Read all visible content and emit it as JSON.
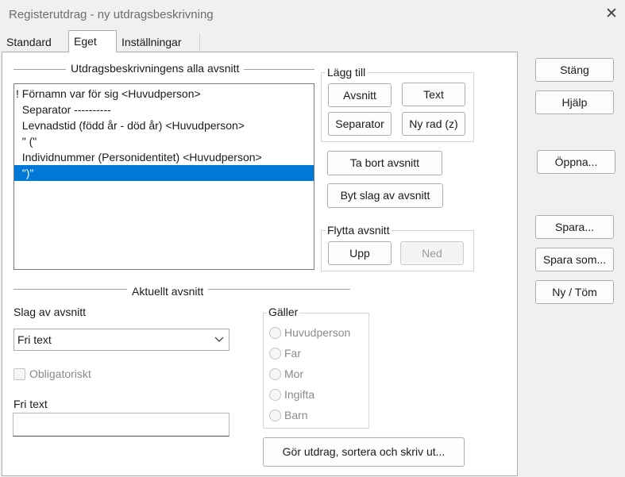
{
  "window": {
    "title": "Registerutdrag - ny utdragsbeskrivning",
    "close_glyph": "✕"
  },
  "tabs": [
    {
      "label": "Standard"
    },
    {
      "label": "Eget"
    },
    {
      "label": "Inställningar"
    }
  ],
  "sections_group": {
    "title": "Utdragsbeskrivningens alla avsnitt",
    "items": [
      "! Förnamn var för sig <Huvudperson>",
      "  Separator ----------",
      "  Levnadstid (född år - död år) <Huvudperson>",
      "  \" (\"",
      "  Individnummer (Personidentitet) <Huvudperson>",
      "  \")\""
    ],
    "selected_index": 5
  },
  "add_group": {
    "title": "Lägg till",
    "buttons": {
      "avsnitt": "Avsnitt",
      "text": "Text",
      "separator": "Separator",
      "new_row": "Ny rad (z)"
    }
  },
  "remove_button": "Ta bort avsnitt",
  "change_type_button": "Byt slag av avsnitt",
  "move_group": {
    "title": "Flytta avsnitt",
    "up": "Upp",
    "down": "Ned"
  },
  "current_group": {
    "title": "Aktuellt avsnitt",
    "type_label": "Slag av avsnitt",
    "type_value": "Fri text",
    "mandatory_label": "Obligatoriskt",
    "free_text_label": "Fri text",
    "free_text_value": ""
  },
  "applies_group": {
    "title": "Gäller",
    "options": [
      "Huvudperson",
      "Far",
      "Mor",
      "Ingifta",
      "Barn"
    ]
  },
  "run_button": "Gör utdrag, sortera och skriv ut...",
  "side_buttons": {
    "close": "Stäng",
    "help": "Hjälp",
    "open": "Öppna...",
    "save": "Spara...",
    "save_as": "Spara som...",
    "new_clear": "Ny / Töm"
  },
  "colors": {
    "selection": "#0078d7",
    "background": "#f0f0f0",
    "panel": "#ffffff"
  }
}
